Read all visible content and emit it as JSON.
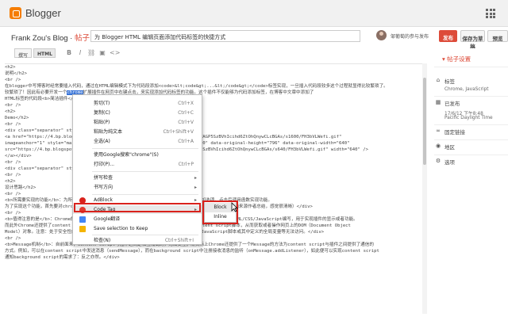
{
  "app": {
    "title": "Blogger",
    "brand_color": "#f57d00"
  },
  "post": {
    "blog_name": "Frank Zou's Blog · ",
    "blog_sub": "帖子",
    "title_value": "为 Blogger HTML 编辑页面添加代码标签的快捷方式",
    "author": "邹葡萄的参与发布",
    "publish": "发布",
    "save_draft": "保存为草稿",
    "preview": "预览"
  },
  "editor": {
    "compose": "撰写",
    "html": "HTML",
    "toolbar_icons": [
      "bold-icon",
      "italic-icon",
      "link-icon",
      "image-icon",
      "code-icon"
    ],
    "lines": [
      "<h2>",
      "说明</h2>",
      "<br />",
      "在blogger中写博客时经常要插入代码，通过在HTML编辑模式下为代码段添加<code>&lt;code&gt;...&lt;/code&gt;</code>标签实现，一旦插入代码段较多这个过程就显得比较繁琐了。",
      "较繁琐了！因此有必要开发一个[selected]chrome扩展插件在网页中右键点击，来实现添加代码标签的功能。这个插件不仅能够为代码添加标签，在博客中文章中添加了",
      "HTML标签的代码段<b>简洁插件</b>",
      "<br />",
      "<h2>",
      "Demo</h2>",
      "<br />",
      "<div class=\"separator\" style=\"clear: both; text-align: center;\">",
      "<a href=\"https://4.bp.blogspot.com/-xxxxxxxx/WbNxxxx/AAAAAAAAABc/d5am1__OWAGP5SzBVhIcihd6ZtOhQnywCLcBGAs/s1600/FH3bVLWefi.gif\"",
      "imageanchor=\"1\" style=\"margin-left: 1em; margin-right: 1em;\"><img border=\"0\" data-original-height=\"796\" data-original-width=\"640\"",
      "src=\"https://4.bp.blogspot.com/-xxxxxxxx/WbNxxxx/AAAAAAAAABc/d5am1__OWAGP5SzBVhIcihd6ZtOhQnywCLcBGAs/s640/FH3bVLWefi.gif\" width=\"640\" />",
      "</a></div>",
      "<br />",
      "<div class=\"separator\" style=\"clear: both; text-align: center;\"></div>",
      "<br />",
      "<h2>",
      "设计思路</h2>",
      "<br />",
      "<b>所需要实现的功能</b>：为所选中的代码添加code标签，使用Chrome扩展，在上下文菜单中添加选项，点击后调用函数实现功能。",
      "为了实现这个功能，首先要对chrome插件的架构有一定的了解。下面给出了Chrome插件的组件的一个基本框架图。（由来源作者总结，感觉很清晰）</div>",
      "<br />",
      "<b>值得注意的是</b>：Chrome的插件里有一个<b>独立</b>的运行环境，可以在popup或者background中通过HTML/CSS/JavaScript编写，用于实现插件的显示或者功能。",
      "而此外Chrome还提供了content script的方式，用于在\"正在的\"网页中注入（injection）content script脚本，从而获取或者操作网页上的DOM（Document Object",
      "Model）对象。注意：处于安全性的考虑，content script只能访问上的DOM对象，而对页面中的JavaScript脚本或其中定义的全局变量等无法访问。</div>",
      "<br />",
      "<b>Message机制</b>：自前面来，content script与插件之间是相互隔离的，无法交互；而实际上Chrome还提供了一个Message的方法为content script与插件之间提供了通信的",
      "方式。例如，可以在content script中发送消息（sendMessage），而在background script中注册接收消息的监听（onMessage.addListener），如此便可以实现content script",
      "通知background script的需求了：反之亦然。</div>"
    ]
  },
  "context_menu": {
    "items": [
      {
        "label": "剪切(T)",
        "shortcut": "Ctrl+X"
      },
      {
        "label": "复制(C)",
        "shortcut": "Ctrl+C"
      },
      {
        "label": "粘贴(P)",
        "shortcut": "Ctrl+V"
      },
      {
        "label": "粘贴为纯文本",
        "shortcut": "Ctrl+Shift+V"
      },
      {
        "label": "全选(A)",
        "shortcut": "Ctrl+A"
      },
      {
        "label": "使用Google搜索\"chrome\"(S)",
        "shortcut": ""
      },
      {
        "label": "打印(P)...",
        "shortcut": "Ctrl+P"
      },
      {
        "label": "拼写检查",
        "shortcut": ""
      },
      {
        "label": "书写方向",
        "shortcut": ""
      },
      {
        "label": "AdBlock",
        "shortcut": ""
      },
      {
        "label": "Code Tag",
        "shortcut": ""
      },
      {
        "label": "Google翻译",
        "shortcut": ""
      },
      {
        "label": "Save selection to Keep",
        "shortcut": ""
      },
      {
        "label": "检查(N)",
        "shortcut": "Ctrl+Shift+I"
      }
    ],
    "submenu": [
      "Block",
      "Inline"
    ],
    "highlight_color": "#d9221c"
  },
  "sidebar": {
    "title": "帖子设置",
    "labels_heading": "标签",
    "labels_value": "Chrome, JavaScript",
    "published_heading": "已发布",
    "published_date": "17/6/12 下午8:48",
    "published_tz": "Pacific Daylight Time",
    "permalink": "固定链接",
    "location": "地区",
    "options": "选项",
    "accent_color": "#dd4b39"
  }
}
